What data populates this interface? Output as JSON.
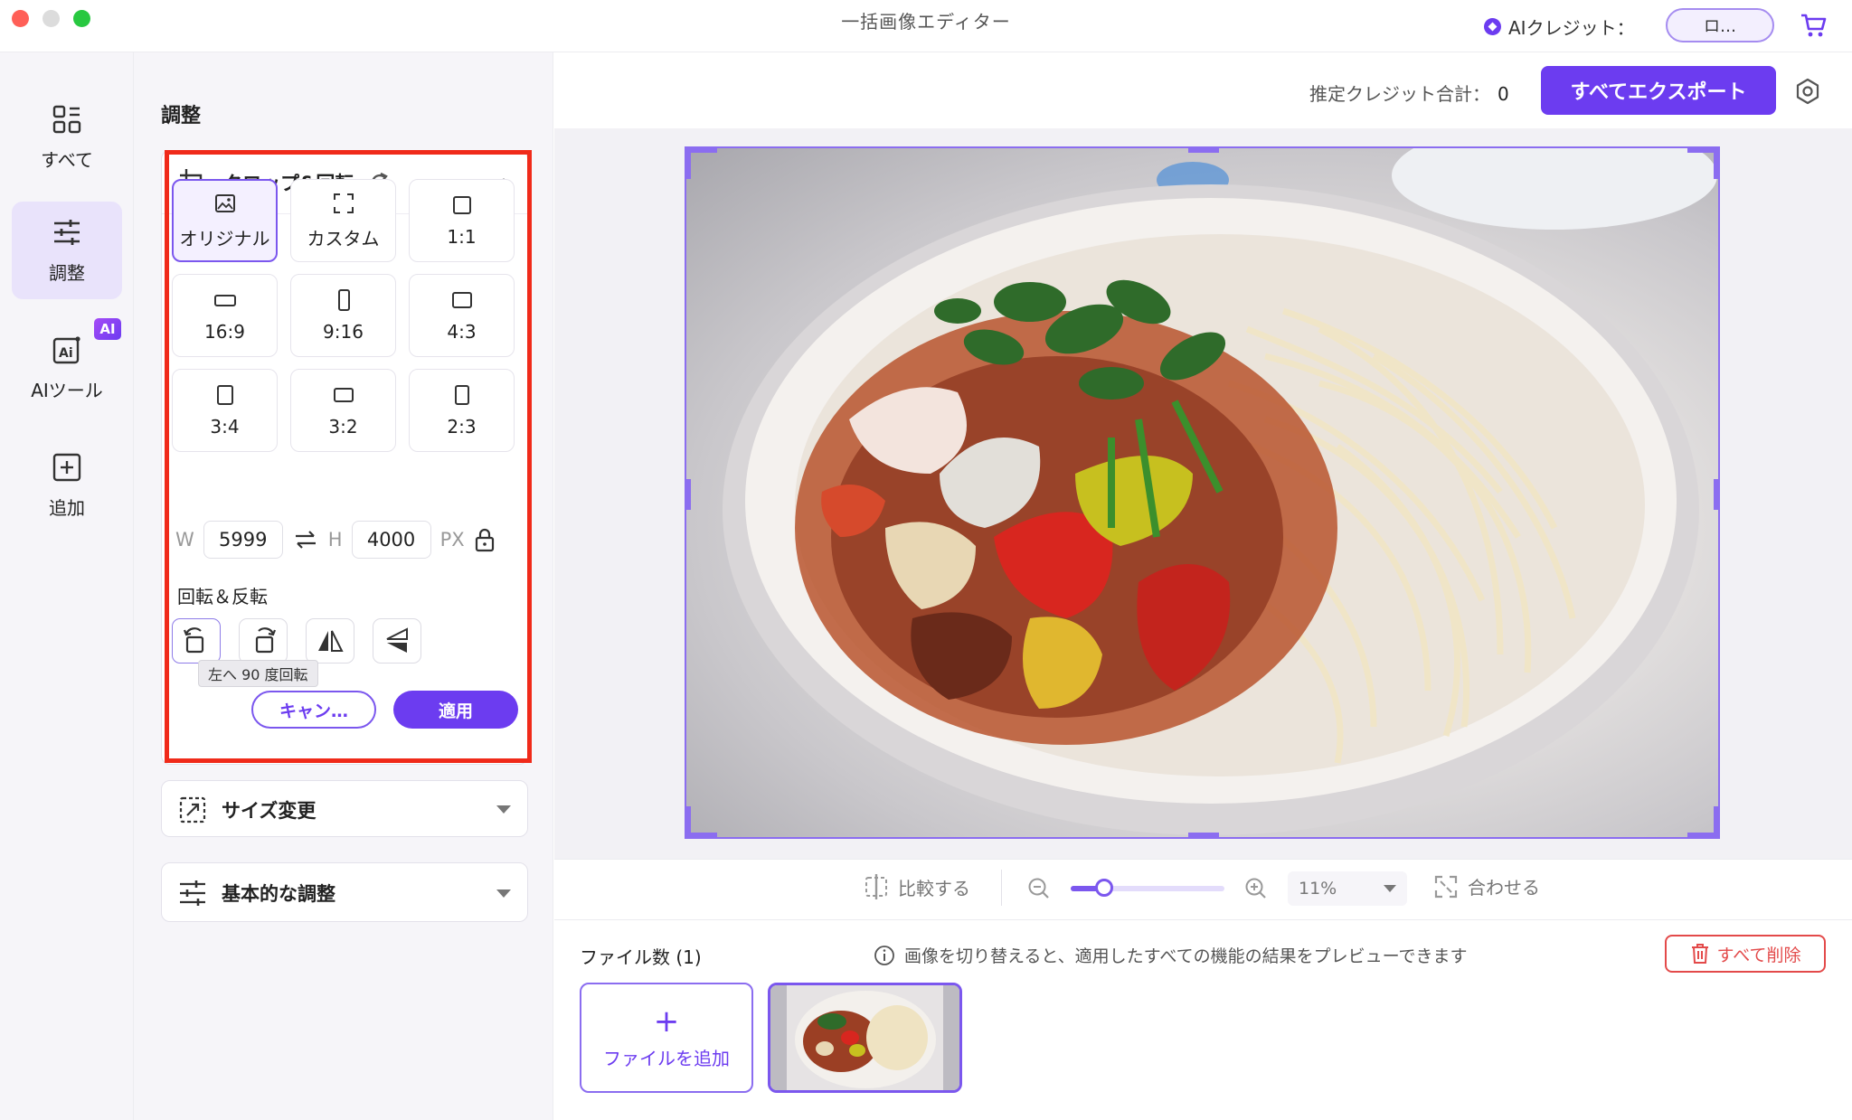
{
  "window": {
    "title": "一括画像エディター"
  },
  "header": {
    "ai_credit_label": "AIクレジット：",
    "login_label": "ロ…"
  },
  "nav": {
    "items": [
      {
        "label": "すべて",
        "icon": "grid-icon"
      },
      {
        "label": "調整",
        "icon": "sliders-icon"
      },
      {
        "label": "AIツール",
        "icon": "ai-tool-icon",
        "badge": "AI"
      },
      {
        "label": "追加",
        "icon": "add-icon"
      }
    ]
  },
  "panel": {
    "title": "調整",
    "crop": {
      "title": "クロップ&回転",
      "ratios": [
        "オリジナル",
        "カスタム",
        "1:1",
        "16:9",
        "9:16",
        "4:3",
        "3:4",
        "3:2",
        "2:3"
      ],
      "selected_ratio": "オリジナル",
      "w_label": "W",
      "width": "5999",
      "h_label": "H",
      "height": "4000",
      "unit": "PX",
      "rotate_title": "回転＆反転",
      "tooltip": "左へ 90 度回転",
      "cancel": "キャン…",
      "apply": "適用"
    },
    "resize": {
      "title": "サイズ変更"
    },
    "basic": {
      "title": "基本的な調整"
    }
  },
  "topbar": {
    "estimate_label": "推定クレジット合計：",
    "estimate_value": "0",
    "export_label": "すべてエクスポート"
  },
  "controls": {
    "compare": "比較する",
    "zoom": "11%",
    "fit": "合わせる",
    "zoom_fraction": 0.22
  },
  "files": {
    "count_label": "ファイル数 (1)",
    "info": "画像を切り替えると、適用したすべての機能の結果をプレビューできます",
    "delete_all": "すべて削除",
    "add_file": "ファイルを追加"
  },
  "colors": {
    "accent": "#6c3cf0",
    "highlight": "#f02a1a",
    "danger": "#e34a4a"
  }
}
